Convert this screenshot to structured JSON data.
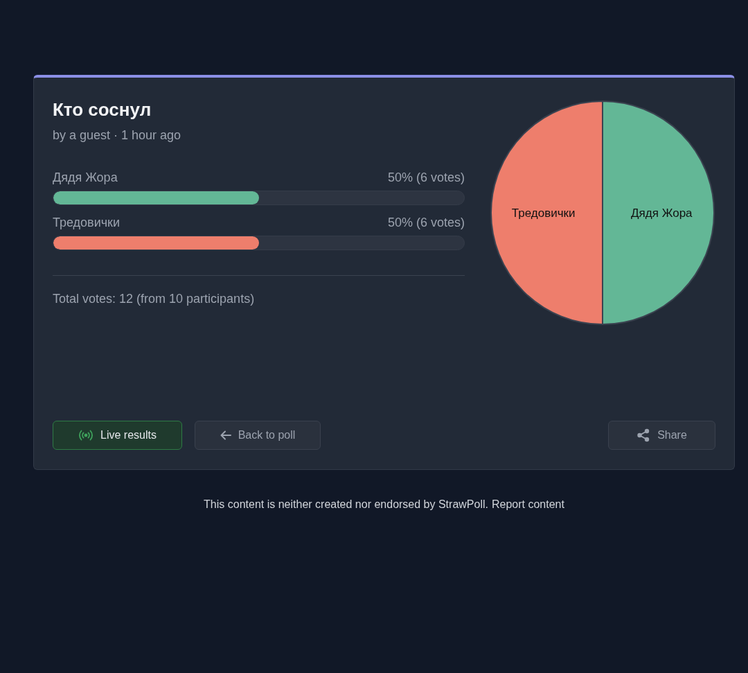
{
  "poll": {
    "title": "Кто соснул",
    "meta": "by a guest · 1 hour ago"
  },
  "options": [
    {
      "label": "Дядя Жора",
      "result": "50% (6 votes)",
      "level": 0.5,
      "color": "#63b796"
    },
    {
      "label": "Тредовички",
      "result": "50% (6 votes)",
      "level": 0.5,
      "color": "#ee7e6c"
    }
  ],
  "total": "Total votes: 12 (from 10 participants)",
  "chart_data": {
    "type": "pie",
    "categories": [
      "Дядя Жора",
      "Тредовички"
    ],
    "values": [
      50,
      50
    ]
  },
  "buttons": [
    {
      "kind": "live",
      "label": "Live results"
    },
    {
      "kind": "back",
      "label": "Back to poll"
    },
    {
      "kind": "share",
      "label": "Share"
    }
  ],
  "footer": {
    "text": "This content is neither created nor endorsed by StrawPoll.",
    "link": "Report content"
  }
}
